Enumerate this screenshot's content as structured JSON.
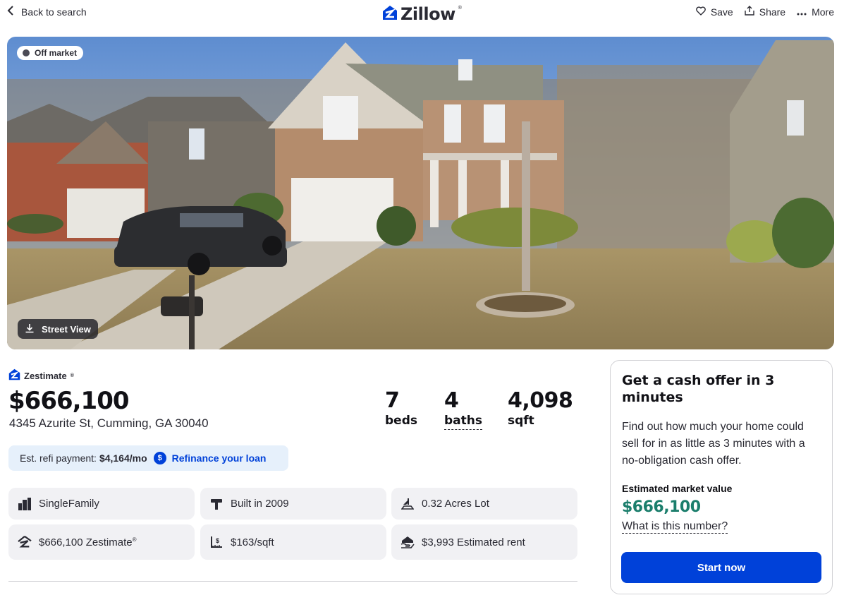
{
  "header": {
    "back_label": "Back to search",
    "logo_text": "Zillow",
    "logo_mark": "®",
    "actions": {
      "save": "Save",
      "share": "Share",
      "more": "More"
    }
  },
  "photo": {
    "badge": "Off market",
    "street_view_label": "Street View"
  },
  "zestimate": {
    "label": "Zestimate",
    "label_mark": "®",
    "price": "$666,100",
    "address": "4345 Azurite St, Cumming, GA 30040"
  },
  "stats": {
    "beds": {
      "value": "7",
      "label": "beds"
    },
    "baths": {
      "value": "4",
      "label": "baths"
    },
    "sqft": {
      "value": "4,098",
      "label": "sqft"
    }
  },
  "refi": {
    "label": "Est. refi payment:",
    "amount": "$4,164/mo",
    "link_icon": "$",
    "link": "Refinance your loan"
  },
  "facts": {
    "type": "SingleFamily",
    "built": "Built in 2009",
    "lot": "0.32 Acres Lot",
    "zestimate": "$666,100 Zestimate",
    "zestimate_mark": "®",
    "price_sqft": "$163/sqft",
    "rent": "$3,993 Estimated rent"
  },
  "cash_offer": {
    "title": "Get a cash offer in 3 minutes",
    "body": "Find out how much your home could sell for in as little as 3 minutes with a no-obligation cash offer.",
    "ev_label": "Estimated market value",
    "ev_value": "$666,100",
    "what_link": "What is this number?",
    "button": "Start now"
  },
  "colors": {
    "brand_blue": "#0041d9",
    "value_green": "#1b7e6c",
    "refi_bg": "#e6f0fb",
    "fact_bg": "#f1f1f4"
  },
  "icons": [
    "chevron-left-icon",
    "zillow-logo-icon",
    "heart-icon",
    "share-icon",
    "more-dots-icon",
    "download-icon",
    "dollar-icon",
    "building-icon",
    "hammer-icon",
    "lot-icon",
    "zestimate-icon",
    "price-sqft-icon",
    "rent-icon"
  ]
}
